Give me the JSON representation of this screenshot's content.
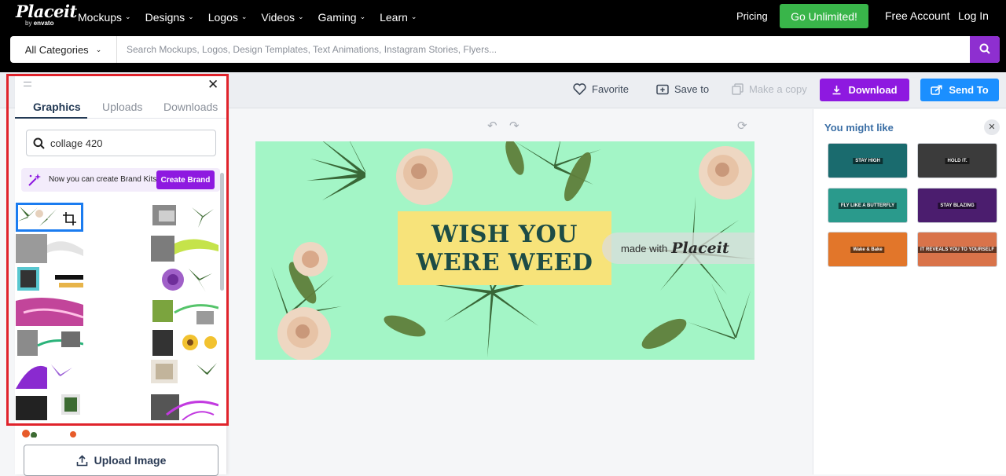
{
  "brand": {
    "logo_word": "Placeit",
    "logo_by": "by",
    "logo_envato": "envato"
  },
  "nav": {
    "items": [
      "Mockups",
      "Designs",
      "Logos",
      "Videos",
      "Gaming",
      "Learn"
    ],
    "pricing": "Pricing",
    "go_unlimited": "Go Unlimited!",
    "free_account": "Free Account",
    "log_in": "Log In"
  },
  "search": {
    "category": "All Categories",
    "placeholder": "Search Mockups, Logos, Design Templates, Text Animations, Instagram Stories, Flyers..."
  },
  "toolbar": {
    "favorite": "Favorite",
    "save_to": "Save to",
    "make_copy": "Make a copy",
    "download": "Download",
    "send_to": "Send To"
  },
  "canvas": {
    "headline_line1": "WISH YOU",
    "headline_line2": "WERE WEED",
    "watermark_made_with": "made with",
    "watermark_brand": "Placeit",
    "colors": {
      "background": "#a3f5c6",
      "banner": "#f7e37a",
      "text": "#1d4c46"
    }
  },
  "left_panel": {
    "tabs": [
      "Graphics",
      "Uploads",
      "Downloads"
    ],
    "active_tab": "Graphics",
    "search_value": "collage 420",
    "brand_kit_text": "Now you can create Brand Kits!",
    "create_brand": "Create Brand",
    "upload_image": "Upload Image"
  },
  "right_panel": {
    "title": "You might like",
    "thumbs": [
      {
        "label": "STAY HIGH",
        "bg": "#1a6b6e"
      },
      {
        "label": "HOLD IT.",
        "bg": "#3b3b3b"
      },
      {
        "label": "FLY LIKE A BUTTERFLY",
        "bg": "#2a9a8c"
      },
      {
        "label": "STAY BLAZING",
        "bg": "#4b1d6e"
      },
      {
        "label": "Wake & Bake",
        "bg": "#e2762a"
      },
      {
        "label": "IT REVEALS YOU TO YOURSELF",
        "bg": "#d9734a"
      }
    ]
  }
}
